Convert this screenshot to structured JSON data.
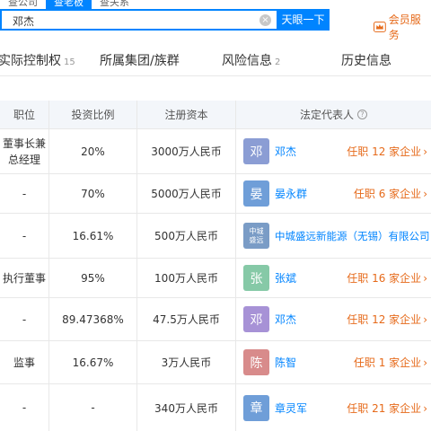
{
  "search": {
    "tabs": [
      "查公司",
      "查老板",
      "查关系"
    ],
    "active_tab": 1,
    "query": "邓杰",
    "button": "天眼一下",
    "vip_label": "会员服务"
  },
  "section_tabs": [
    {
      "label": "实际控制权",
      "count": "15"
    },
    {
      "label": "所属集团/族群",
      "count": ""
    },
    {
      "label": "风险信息",
      "count": "2"
    },
    {
      "label": "历史信息",
      "count": ""
    }
  ],
  "table": {
    "headers": [
      "职位",
      "投资比例",
      "注册资本",
      "法定代表人"
    ],
    "rows": [
      {
        "position": "董事长兼总经理",
        "ratio": "20%",
        "capital": "3000万人民币",
        "avatar": "邓",
        "avatar_color": "#8b9dd4",
        "name": "邓杰",
        "tenure": "任职 12 家企业"
      },
      {
        "position": "-",
        "ratio": "70%",
        "capital": "5000万人民币",
        "avatar": "晏",
        "avatar_color": "#6f9ed8",
        "name": "晏永群",
        "tenure": "任职 6 家企业"
      },
      {
        "position": "-",
        "ratio": "16.61%",
        "capital": "500万人民币",
        "avatar": "中城盛远",
        "avatar_color": "#7a9cc6",
        "name": "中城盛远新能源（无锡）有限公司",
        "tenure": ""
      },
      {
        "position": "执行董事",
        "ratio": "95%",
        "capital": "100万人民币",
        "avatar": "张",
        "avatar_color": "#86c9a7",
        "name": "张斌",
        "tenure": "任职 16 家企业"
      },
      {
        "position": "-",
        "ratio": "89.47368%",
        "capital": "47.5万人民币",
        "avatar": "邓",
        "avatar_color": "#a792d6",
        "name": "邓杰",
        "tenure": "任职 12 家企业"
      },
      {
        "position": "监事",
        "ratio": "16.67%",
        "capital": "3万人民币",
        "avatar": "陈",
        "avatar_color": "#d88b8b",
        "name": "陈智",
        "tenure": "任职 1 家企业"
      },
      {
        "position": "-",
        "ratio": "-",
        "capital": "340万人民币",
        "avatar": "章",
        "avatar_color": "#6f9ed8",
        "name": "章灵军",
        "tenure": "任职 21 家企业"
      }
    ]
  },
  "colors": {
    "accent": "#0084ff",
    "orange": "#e66a1a",
    "header_bg": "#f3f6fa"
  }
}
